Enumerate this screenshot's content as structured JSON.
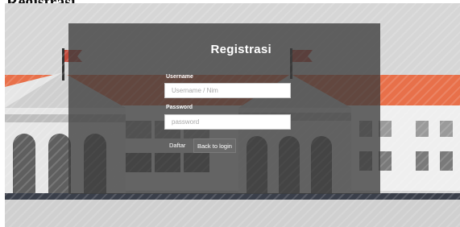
{
  "page": {
    "heading": "Registrasi"
  },
  "form": {
    "title": "Registrasi",
    "username": {
      "label": "Username",
      "placeholder": "Username / Nim",
      "value": ""
    },
    "password": {
      "label": "Password",
      "placeholder": "password",
      "value": ""
    },
    "buttons": {
      "register": "Daftar",
      "back": "Back to login"
    }
  },
  "colors": {
    "accent": "#e8704a",
    "panel": "#3c3c3c",
    "background": "#d8d8d8"
  }
}
